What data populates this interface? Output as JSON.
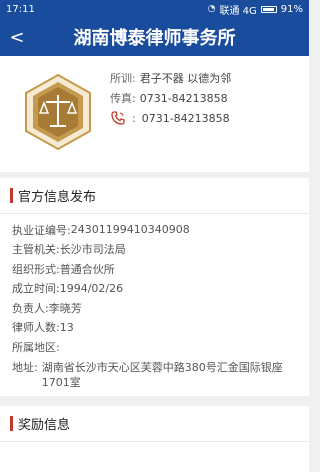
{
  "status": {
    "time": "17:11",
    "carrier": "联通 4G",
    "battery": "91%"
  },
  "nav": {
    "back": "<",
    "title": "湖南博泰律师事务所"
  },
  "profile": {
    "motto_label": "所训:",
    "motto": "君子不器 以德为邻",
    "fax_label": "传真:",
    "fax": "0731-84213858",
    "phone_sep": ":",
    "phone": "0731-84213858"
  },
  "official": {
    "heading": "官方信息发布",
    "rows": [
      {
        "label": "执业证编号:",
        "value": "24301199410340908"
      },
      {
        "label": "主管机关:",
        "value": "长沙市司法局"
      },
      {
        "label": "组织形式:",
        "value": "普通合伙所"
      },
      {
        "label": "成立时间:",
        "value": "1994/02/26"
      },
      {
        "label": "负责人:",
        "value": "李晓芳"
      },
      {
        "label": "律师人数:",
        "value": "13"
      },
      {
        "label": "所属地区:",
        "value": ""
      }
    ],
    "address_label": "地址:",
    "address": "湖南省长沙市天心区芙蓉中路380号汇金国际银座1701室"
  },
  "awards": {
    "heading": "奖励信息"
  },
  "colors": {
    "brand": "#1a4c9e",
    "accent": "#c0392b",
    "emblem_gold": "#c59a4e"
  }
}
